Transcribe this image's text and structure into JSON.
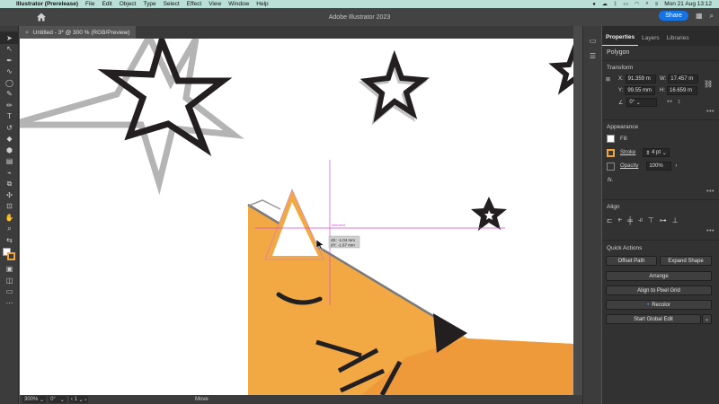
{
  "menubar": {
    "items": [
      "Illustrator (Prerelease)",
      "File",
      "Edit",
      "Object",
      "Type",
      "Select",
      "Effect",
      "View",
      "Window",
      "Help"
    ],
    "clock": "Mon 21 Aug 13:12"
  },
  "appbar": {
    "title": "Adobe Illustrator 2023",
    "share_label": "Share"
  },
  "document": {
    "tab_title": "Untitled - 3* @ 300 % (RGB/Preview)"
  },
  "canvas": {
    "smart_guide_label": "intersect",
    "tooltip_line1": "dX: -1.04 mm",
    "tooltip_line2": "dY: -1.67 mm"
  },
  "statusbar": {
    "zoom": "300%",
    "rotation": "0°",
    "artboard": "1",
    "mode": "Move"
  },
  "panel": {
    "tabs": [
      "Properties",
      "Layers",
      "Libraries"
    ],
    "selection_type": "Polygon",
    "transform": {
      "title": "Transform",
      "x_label": "X:",
      "x_value": "91.359 m",
      "y_label": "Y:",
      "y_value": "99.55 mm",
      "w_label": "W:",
      "w_value": "17.457 m",
      "h_label": "H:",
      "h_value": "16.659 m",
      "rotate_value": "0°"
    },
    "appearance": {
      "title": "Appearance",
      "fill_label": "Fill",
      "stroke_label": "Stroke",
      "stroke_value": "4 pt",
      "opacity_label": "Opacity",
      "opacity_value": "100%",
      "fx_label": "fx."
    },
    "align": {
      "title": "Align"
    },
    "quick_actions": {
      "title": "Quick Actions",
      "offset_path": "Offset Path",
      "expand_shape": "Expand Shape",
      "arrange": "Arrange",
      "align_pixel_grid": "Align to Pixel Grid",
      "recolor": "Recolor",
      "start_global_edit": "Start Global Edit"
    }
  },
  "colors": {
    "accent": "#1473e6",
    "stroke_swatch": "#f0a43c",
    "fox_orange": "#f2a944",
    "smart_guide": "#d04fd0"
  }
}
